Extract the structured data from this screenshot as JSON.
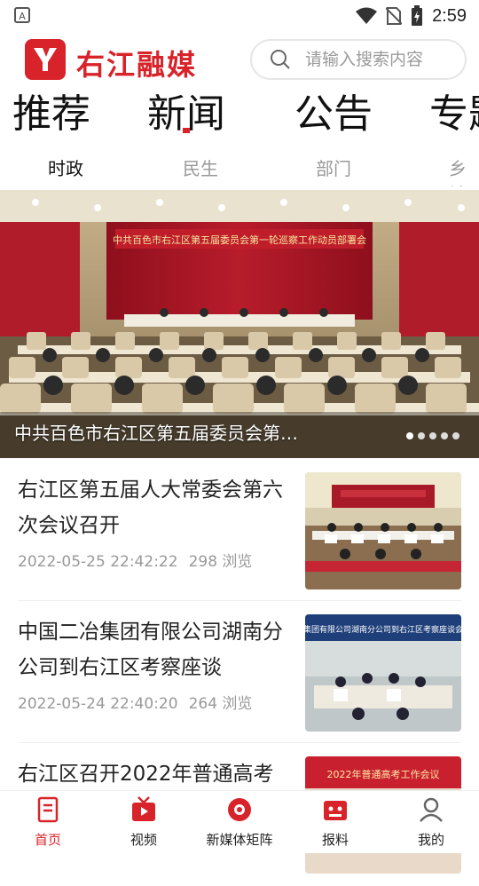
{
  "status_bar": {
    "time": "2:59",
    "icons": [
      "app-notification-icon",
      "wifi-icon",
      "no-sim-icon",
      "battery-charging-icon"
    ]
  },
  "header": {
    "brand_name": "右江融媒",
    "logo_icon": "brand-logo-icon",
    "search": {
      "placeholder": "请输入搜索内容",
      "icon": "search-icon"
    }
  },
  "category_tabs": [
    {
      "label": "推荐"
    },
    {
      "label": "新闻"
    },
    {
      "label": "公告"
    },
    {
      "label": "专题"
    }
  ],
  "sub_tabs": [
    {
      "label": "时政"
    },
    {
      "label": "民生"
    },
    {
      "label": "部门"
    },
    {
      "label": "乡镇"
    }
  ],
  "banner": {
    "banner_text": "中共百色市右江区第五届委员会第一轮巡察工作动员部署会",
    "caption": "中共百色市右江区第五届委员会第…",
    "dots_total": 5,
    "dots_active_index": 0
  },
  "news": [
    {
      "title": "右江区第五届人大常委会第六次会议召开",
      "datetime": "2022-05-25 22:42:22",
      "views": "298 浏览"
    },
    {
      "title": "中国二冶集团有限公司湖南分公司到右江区考察座谈",
      "datetime": "2022-05-24 22:40:20",
      "views": "264 浏览",
      "thumb_banner": "集团有限公司湖南分公司到右江区考察座谈会"
    },
    {
      "title": "右江区召开2022年普通高考",
      "thumb_banner": "2022年普通高考工作会议"
    }
  ],
  "bottom_nav": [
    {
      "label": "首页",
      "icon": "home-document-icon"
    },
    {
      "label": "视频",
      "icon": "tv-play-icon"
    },
    {
      "label": "新媒体矩阵",
      "icon": "media-matrix-icon"
    },
    {
      "label": "报料",
      "icon": "report-tip-icon"
    },
    {
      "label": "我的",
      "icon": "profile-icon"
    }
  ],
  "colors": {
    "brand": "#d8232a",
    "muted": "#999999",
    "text": "#222222"
  }
}
